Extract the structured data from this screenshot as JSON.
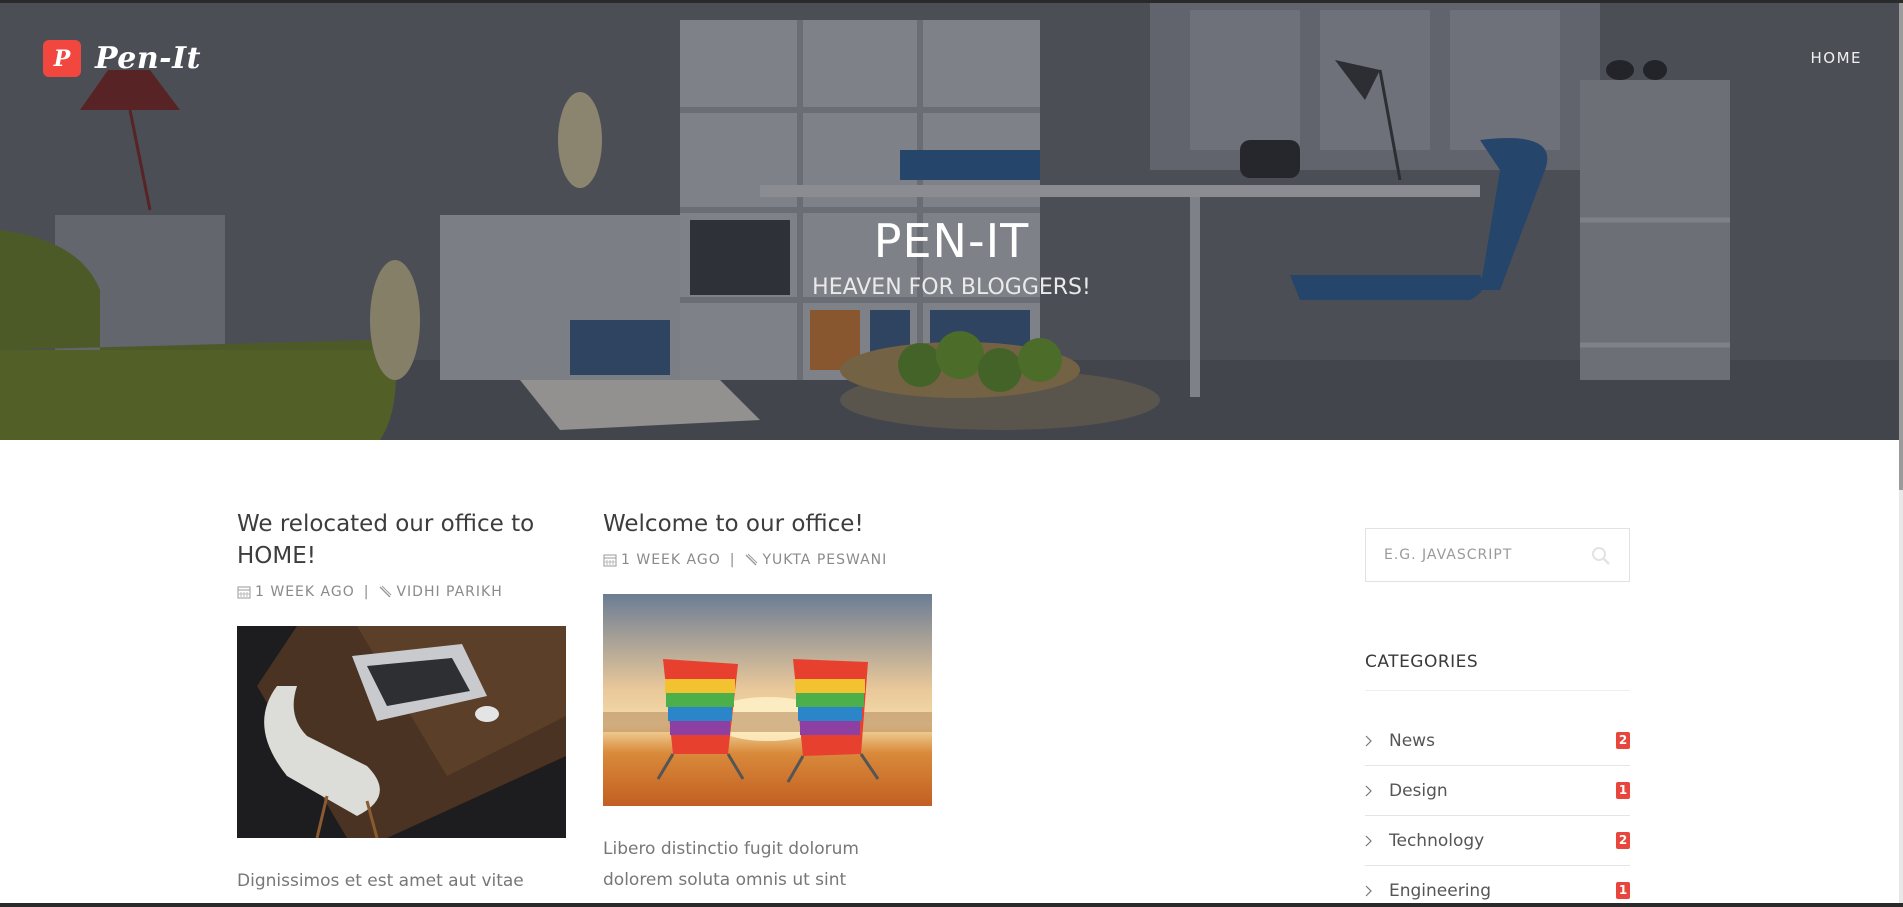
{
  "header": {
    "logo_letter": "P",
    "logo_text": "Pen-It",
    "nav": {
      "home_label": "HOME"
    }
  },
  "hero": {
    "title": "PEN-IT",
    "subtitle": "HEAVEN FOR BLOGGERS!"
  },
  "posts": [
    {
      "title": "We relocated our office to HOME!",
      "time": "1 WEEK AGO",
      "separator": "|",
      "author": "VIDHI PARIKH",
      "image": "laptop-desk-photo",
      "excerpt": "Dignissimos et est amet aut vitae beatae"
    },
    {
      "title": "Welcome to our office!",
      "time": "1 WEEK AGO",
      "separator": "|",
      "author": "YUKTA PESWANI",
      "image": "beach-chairs-sunset-photo",
      "excerpt": "Libero distinctio fugit dolorum dolorem soluta omnis ut sint doloribus."
    }
  ],
  "sidebar": {
    "search": {
      "placeholder": "E.G. JAVASCRIPT",
      "icon": "search-icon"
    },
    "categories_heading": "CATEGORIES",
    "categories": [
      {
        "label": "News",
        "count": "2"
      },
      {
        "label": "Design",
        "count": "1"
      },
      {
        "label": "Technology",
        "count": "2"
      },
      {
        "label": "Engineering",
        "count": "1"
      }
    ]
  },
  "colors": {
    "accent": "#f2473f",
    "badge": "#e8453c",
    "text_dark": "#3d3d3d",
    "text_muted": "#8a8a8a"
  }
}
